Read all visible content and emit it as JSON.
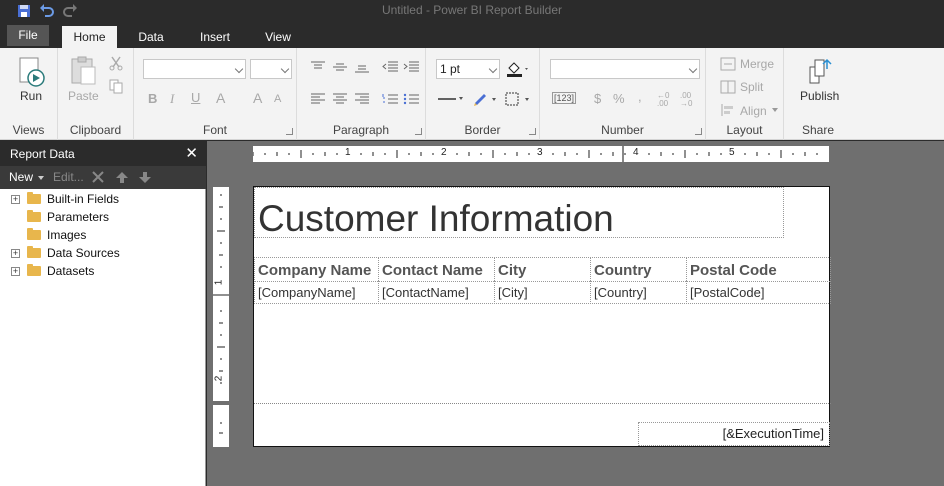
{
  "app": {
    "title": "Untitled - Power BI Report Builder"
  },
  "tabs": [
    "File",
    "Home",
    "Data",
    "Insert",
    "View"
  ],
  "ribbon": {
    "views": {
      "run": "Run",
      "group": "Views"
    },
    "clipboard": {
      "paste": "Paste",
      "group": "Clipboard"
    },
    "font": {
      "group": "Font"
    },
    "paragraph": {
      "group": "Paragraph"
    },
    "border": {
      "width": "1 pt",
      "group": "Border"
    },
    "number": {
      "group": "Number",
      "placeholder": "[123]"
    },
    "layout": {
      "merge": "Merge",
      "split": "Split",
      "align": "Align",
      "group": "Layout"
    },
    "share": {
      "publish": "Publish",
      "group": "Share"
    }
  },
  "panel": {
    "title": "Report Data",
    "new_label": "New",
    "edit_label": "Edit...",
    "tree": [
      {
        "label": "Built-in Fields",
        "expandable": true
      },
      {
        "label": "Parameters",
        "expandable": false
      },
      {
        "label": "Images",
        "expandable": false
      },
      {
        "label": "Data Sources",
        "expandable": true
      },
      {
        "label": "Datasets",
        "expandable": true
      }
    ]
  },
  "ruler": {
    "h_marks": [
      "1",
      "2",
      "3",
      "4",
      "5"
    ],
    "v_marks": [
      "1",
      "2"
    ]
  },
  "report": {
    "title": "Customer Information",
    "columns": [
      "Company Name",
      "Contact Name",
      "City",
      "Country",
      "Postal Code"
    ],
    "fields": [
      "[CompanyName]",
      "[ContactName]",
      "[City]",
      "[Country]",
      "[PostalCode]"
    ],
    "footer": "[&ExecutionTime]"
  },
  "colors": {
    "folder": "#e8b64c",
    "chrome": "#2b2b2b",
    "ribbon": "#f3f3f3",
    "canvas_bg": "#6f6f6f"
  }
}
